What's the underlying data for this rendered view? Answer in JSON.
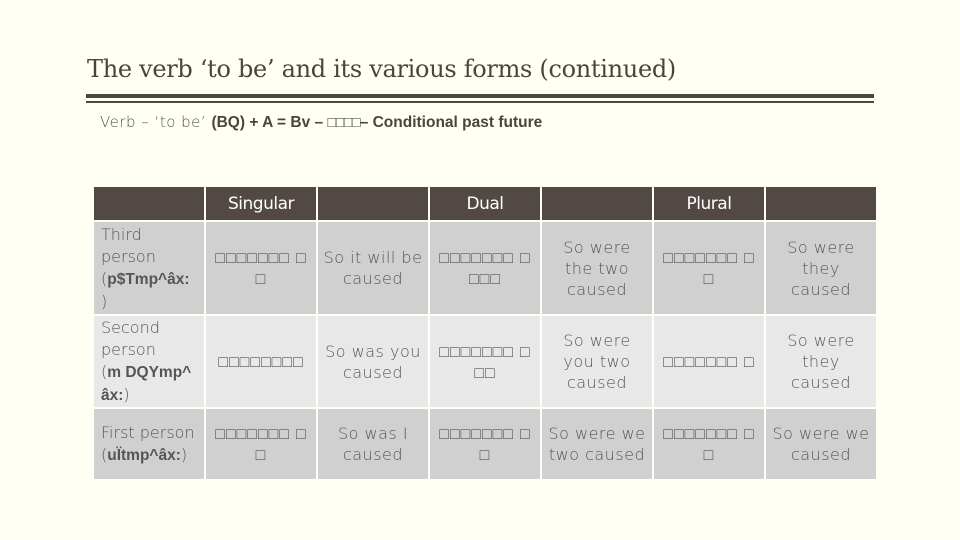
{
  "title": "The verb ‘to be’ and its various forms (continued)",
  "subtitle": {
    "prefix": "Verb – ‘to be’ ",
    "formula": "(BQ) + A = Bv – ",
    "native": "□□□□",
    "suffix": "– Conditional past future"
  },
  "table": {
    "headers": [
      "",
      "Singular",
      "",
      "Dual",
      "",
      "Plural",
      ""
    ],
    "rows": [
      {
        "person": "Third person",
        "translit": "p$Tmp^âx:",
        "singular_native": "□□□□□□□ □□",
        "singular_english": "So it will be caused",
        "dual_native": "□□□□□□□ □□□□",
        "dual_english": "So were the two caused",
        "plural_native": "□□□□□□□ □□",
        "plural_english": "So were they caused"
      },
      {
        "person": "Second person",
        "translit": "m DQYmp^ âx:",
        "singular_native": "□□□□□□□□",
        "singular_english": "So was you caused",
        "dual_native": "□□□□□□□ □□□",
        "dual_english": "So were you two caused",
        "plural_native": "□□□□□□□ □",
        "plural_english": "So were they caused"
      },
      {
        "person": "First person",
        "translit": "uÏtmp^âx:",
        "singular_native": "□□□□□□□ □□",
        "singular_english": "So was I caused",
        "dual_native": "□□□□□□□ □□",
        "dual_english": "So were we two caused",
        "plural_native": "□□□□□□□ □□",
        "plural_english": "So were we caused"
      }
    ]
  }
}
